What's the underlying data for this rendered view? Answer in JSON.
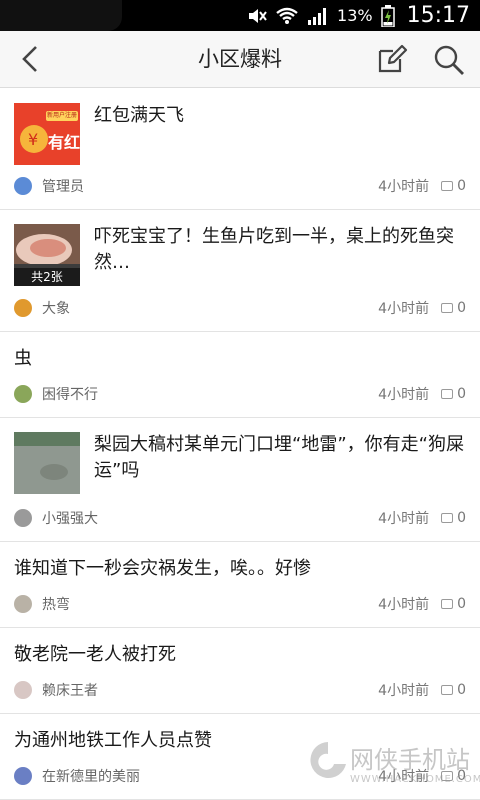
{
  "status_bar": {
    "battery": "13%",
    "time": "15:17"
  },
  "header": {
    "title": "小区爆料"
  },
  "posts": [
    {
      "title": "红包满天飞",
      "author": "管理员",
      "time": "4小时前",
      "comments": "0"
    },
    {
      "title": "吓死宝宝了！生鱼片吃到一半，桌上的死鱼突然…",
      "author": "大象",
      "time": "4小时前",
      "comments": "0",
      "image_count": "共2张"
    },
    {
      "title": "虫",
      "author": "困得不行",
      "time": "4小时前",
      "comments": "0"
    },
    {
      "title": "梨园大稿村某单元门口埋“地雷”，你有走“狗屎运”吗",
      "author": "小强强大",
      "time": "4小时前",
      "comments": "0"
    },
    {
      "title": "谁知道下一秒会灾祸发生，唉。。好惨",
      "author": "热弯",
      "time": "4小时前",
      "comments": "0"
    },
    {
      "title": "敬老院一老人被打死",
      "author": "赖床王者",
      "time": "4小时前",
      "comments": "0"
    },
    {
      "title": "为通州地铁工作人员点赞",
      "author": "在新德里的美丽",
      "time": "4小时前",
      "comments": "0"
    }
  ],
  "thumb_labels": {
    "redpacket_banner": "有红",
    "redpacket_tag": "新用户注册"
  },
  "watermark": {
    "brand": "网侠手机站",
    "url": "WWW.HACKHOME.COM"
  },
  "colors": {
    "accent_red": "#e8412a",
    "header_bg": "#f7f7f7"
  }
}
